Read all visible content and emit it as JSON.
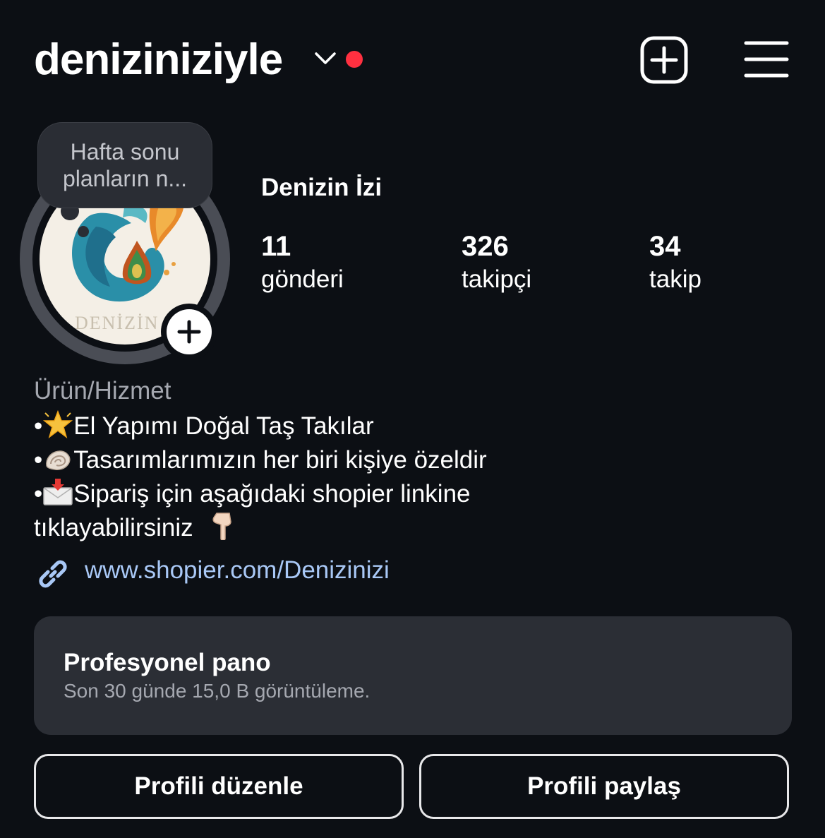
{
  "header": {
    "username": "deniziniziyle",
    "has_notification_dot": true,
    "notification_color": "#ff3040",
    "create_icon": "plus-square-icon",
    "menu_icon": "hamburger-menu-icon"
  },
  "note": {
    "text": "Hafta sonu\nplanların n..."
  },
  "avatar": {
    "logo_text": "DENİZİN İ",
    "add_icon": "plus-icon"
  },
  "profile": {
    "display_name": "Denizin İzi",
    "stats": [
      {
        "value": "11",
        "label": "gönderi"
      },
      {
        "value": "326",
        "label": "takipçi"
      },
      {
        "value": "34",
        "label": "takip"
      }
    ]
  },
  "bio": {
    "category": "Ürün/Hizmet",
    "lines": [
      {
        "bullet": "•",
        "emoji": "glowing-star",
        "text": "El Yapımı Doğal Taş Takılar"
      },
      {
        "bullet": "•",
        "emoji": "spiral-shell",
        "text": "Tasarımlarımızın her biri kişiye özeldir"
      },
      {
        "bullet": "•",
        "emoji": "incoming-envelope",
        "text": "Sipariş için aşağıdaki shopier linkine"
      }
    ],
    "last_line": "tıklayabilirsiniz",
    "last_emoji": "backhand-index-pointing-down",
    "link": "www.shopier.com/Denizinizi",
    "link_icon": "link-icon",
    "link_color": "#a9c8f6"
  },
  "dashboard": {
    "title": "Profesyonel pano",
    "subtitle": "Son 30 günde 15,0 B görüntüleme."
  },
  "buttons": {
    "edit": "Profili düzenle",
    "share": "Profili paylaş"
  }
}
